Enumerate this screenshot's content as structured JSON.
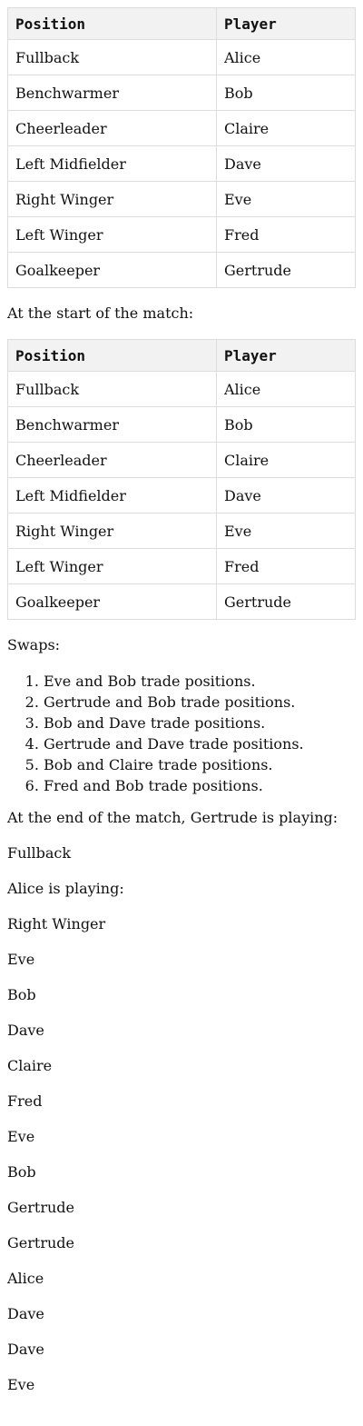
{
  "table_headers": {
    "position": "Position",
    "player": "Player"
  },
  "roster_table_1": [
    {
      "position": "Fullback",
      "player": "Alice"
    },
    {
      "position": "Benchwarmer",
      "player": "Bob"
    },
    {
      "position": "Cheerleader",
      "player": "Claire"
    },
    {
      "position": "Left Midfielder",
      "player": "Dave"
    },
    {
      "position": "Right Winger",
      "player": "Eve"
    },
    {
      "position": "Left Winger",
      "player": "Fred"
    },
    {
      "position": "Goalkeeper",
      "player": "Gertrude"
    }
  ],
  "start_caption": "At the start of the match:",
  "roster_table_2": [
    {
      "position": "Fullback",
      "player": "Alice"
    },
    {
      "position": "Benchwarmer",
      "player": "Bob"
    },
    {
      "position": "Cheerleader",
      "player": "Claire"
    },
    {
      "position": "Left Midfielder",
      "player": "Dave"
    },
    {
      "position": "Right Winger",
      "player": "Eve"
    },
    {
      "position": "Left Winger",
      "player": "Fred"
    },
    {
      "position": "Goalkeeper",
      "player": "Gertrude"
    }
  ],
  "swaps_title": "Swaps:",
  "swaps": [
    "Eve and Bob trade positions.",
    "Gertrude and Bob trade positions.",
    "Bob and Dave trade positions.",
    "Gertrude and Dave trade positions.",
    "Bob and Claire trade positions.",
    "Fred and Bob trade positions."
  ],
  "end_lines": [
    "At the end of the match, Gertrude is playing:",
    "Fullback",
    "Alice is playing:",
    "Right Winger",
    "Eve",
    "Bob",
    "Dave",
    "Claire",
    "Fred",
    "Eve",
    "Bob",
    "Gertrude",
    "Gertrude",
    "Alice",
    "Dave",
    "Dave",
    "Eve"
  ]
}
